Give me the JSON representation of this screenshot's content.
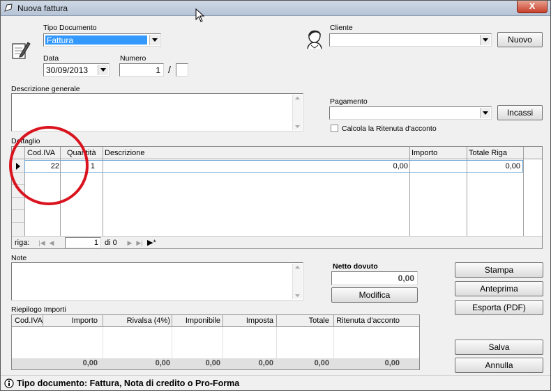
{
  "window": {
    "title": "Nuova fattura",
    "close_label": "X"
  },
  "header": {
    "tipo_documento_label": "Tipo Documento",
    "tipo_documento_value": "Fattura",
    "data_label": "Data",
    "data_value": "30/09/2013",
    "numero_label": "Numero",
    "numero_value": "1",
    "numero_separator": "/",
    "numero_suffix": "",
    "cliente_label": "Cliente",
    "cliente_value": "",
    "nuovo_button": "Nuovo",
    "descrizione_label": "Descrizione generale",
    "descrizione_value": "",
    "pagamento_label": "Pagamento",
    "pagamento_value": "",
    "incassi_button": "Incassi",
    "ritenuta_checkbox_label": "Calcola la Ritenuta d'acconto",
    "ritenuta_checked": false
  },
  "dettaglio": {
    "label": "Dettaglio",
    "columns": [
      "Cod.IVA",
      "Quantità",
      "Descrizione",
      "Importo",
      "Totale Riga"
    ],
    "rows": [
      {
        "cod_iva": "22",
        "quantita": "1",
        "descrizione": "",
        "importo": "0,00",
        "totale_riga": "0,00"
      }
    ],
    "nav": {
      "label": "riga:",
      "current": "1",
      "of": "di 0"
    }
  },
  "note": {
    "label": "Note",
    "value": ""
  },
  "netto": {
    "label": "Netto dovuto",
    "value": "0,00",
    "modifica_button": "Modifica"
  },
  "actions": {
    "stampa": "Stampa",
    "anteprima": "Anteprima",
    "esporta": "Esporta (PDF)",
    "salva": "Salva",
    "annulla": "Annulla"
  },
  "riepilogo": {
    "label": "Riepilogo Importi",
    "columns": [
      "Cod.IVA",
      "Importo",
      "Rivalsa (4%)",
      "Imponibile",
      "Imposta",
      "Totale",
      "Ritenuta d'acconto"
    ],
    "totals": [
      "",
      "0,00",
      "0,00",
      "0,00",
      "0,00",
      "0,00",
      "0,00"
    ]
  },
  "status": {
    "text": "Tipo documento: Fattura, Nota di credito o Pro-Forma"
  },
  "colors": {
    "highlight_circle": "#d9141f",
    "selection": "#3399ff",
    "titlebar": "#b6c4d6"
  },
  "icons": [
    "pencil-note-icon",
    "person-icon",
    "info-icon",
    "cursor-icon"
  ]
}
